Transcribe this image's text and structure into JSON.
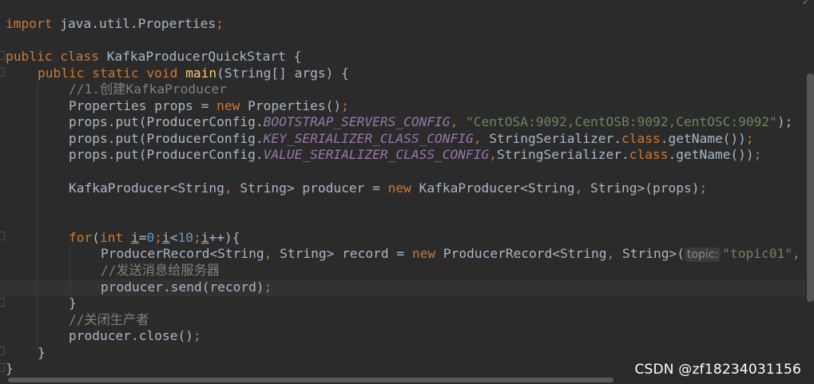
{
  "editor": {
    "line_import": {
      "kw": "import",
      "rest": " java.util.Properties",
      "semi": ";"
    },
    "line_class": {
      "kw": "public class",
      "rest": " KafkaProducerQuickStart {"
    },
    "line_main": {
      "kw1": "public static void",
      "fn": "main",
      "rest": "(String[] args) {"
    },
    "line_comment1": "//1.创建KafkaProducer",
    "line_props": {
      "a": "Properties props = ",
      "kw": "new",
      "b": " Properties()",
      "semi": ";"
    },
    "line_put1": {
      "a": "props.put(ProducerConfig.",
      "const": "BOOTSTRAP_SERVERS_CONFIG",
      "comma": ",",
      "str": " \"CentOSA:9092,CentOSB:9092,CentOSC:9092\"",
      "b": ");"
    },
    "line_put2": {
      "a": "props.put(ProducerConfig.",
      "const": "KEY_SERIALIZER_CLASS_CONFIG",
      "comma": ",",
      "b": " StringSerializer.",
      "kw": "class",
      "c": ".getName())",
      "semi": ";"
    },
    "line_put3": {
      "a": "props.put(ProducerConfig.",
      "const": "VALUE_SERIALIZER_CLASS_CONFIG",
      "comma": ",",
      "b": "StringSerializer.",
      "kw": "class",
      "c": ".getName())",
      "semi": ";"
    },
    "line_producer": {
      "a": "KafkaProducer<String",
      "comma": ",",
      "b": " String> producer = ",
      "kw": "new",
      "c": " KafkaProducer<String",
      "comma2": ",",
      "d": " String>(props)",
      "semi": ";"
    },
    "line_for": {
      "kw": "for",
      "a": "(",
      "kw2": "int",
      "sp": " ",
      "i1": "i",
      "eq": "=",
      "n0": "0",
      "semi1": ";",
      "i2": "i",
      "lt": "<",
      "n10": "10",
      "semi2": ";",
      "i3": "i",
      "b": "++){"
    },
    "line_record": {
      "a": "ProducerRecord<String",
      "comma": ",",
      "b": " String> record = ",
      "kw": "new",
      "c": " ProducerRecord<String",
      "comma2": ",",
      "d": " String>(",
      "hint": "topic:",
      "str": "\"topic01\"",
      "e": ","
    },
    "line_comment2": "//发送消息给服务器",
    "line_send": {
      "a": "producer.send(record)",
      "semi": ";"
    },
    "line_close_for": "}",
    "line_comment3": "//关闭生产者",
    "line_close": {
      "a": "producer.close()",
      "semi": ";"
    },
    "line_close_main": "}",
    "line_close_class": "}"
  },
  "watermark": "CSDN @zf18234031156",
  "colors": {
    "background": "#2b2b2b",
    "keyword": "#cc7832",
    "function": "#ffc66d",
    "string": "#6a8759",
    "number": "#6897bb",
    "comment": "#808080",
    "constant": "#9876aa",
    "text": "#a9b7c6"
  },
  "icons": {
    "inspection": "check-icon"
  }
}
